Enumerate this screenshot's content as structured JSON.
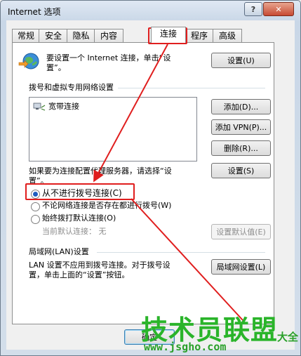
{
  "window": {
    "title": "Internet 选项",
    "help_label": "?",
    "close_label": "✕"
  },
  "tabs": [
    {
      "label": "常规"
    },
    {
      "label": "安全"
    },
    {
      "label": "隐私"
    },
    {
      "label": "内容"
    },
    {
      "label": "连接",
      "active": true
    },
    {
      "label": "程序"
    },
    {
      "label": "高级"
    }
  ],
  "setup": {
    "text_line1": "要设置一个 Internet 连接，单击“设",
    "text_line2": "置”。",
    "button": "设置(U)",
    "icon": "globe-connection-icon"
  },
  "dialup": {
    "heading": "拨号和虚拟专用网络设置",
    "connections": [
      {
        "name": "宽带连接",
        "icon": "broadband-connection-icon"
      }
    ],
    "add_button": "添加(D)...",
    "add_vpn_button": "添加 VPN(P)...",
    "remove_button": "删除(R)...",
    "proxy_text_line1": "如果要为连接配置代理服务器，请选择“设",
    "proxy_text_line2": "置”。",
    "settings_button": "设置(S)",
    "options": [
      {
        "label": "从不进行拨号连接(C)",
        "selected": true
      },
      {
        "label": "不论网络连接是否存在都进行拨号(W)",
        "selected": false
      },
      {
        "label": "始终拨打默认连接(O)",
        "selected": false
      }
    ],
    "current_default": "当前默认连接：  无",
    "set_default_button": "设置默认值(E)"
  },
  "lan": {
    "heading": "局域网(LAN)设置",
    "text_line1": "LAN 设置不应用到拨号连接。对于拨号设",
    "text_line2": "置，单击上面的“设置”按钮。",
    "button": "局域网设置(L)"
  },
  "footer": {
    "ok_button": "确定"
  },
  "watermark": {
    "text": "技术员联盟",
    "url": "www.jsgho.com",
    "suffix": "大全"
  },
  "colors": {
    "annotation_red": "#e01e1e",
    "watermark_green": "#2ab42a"
  }
}
